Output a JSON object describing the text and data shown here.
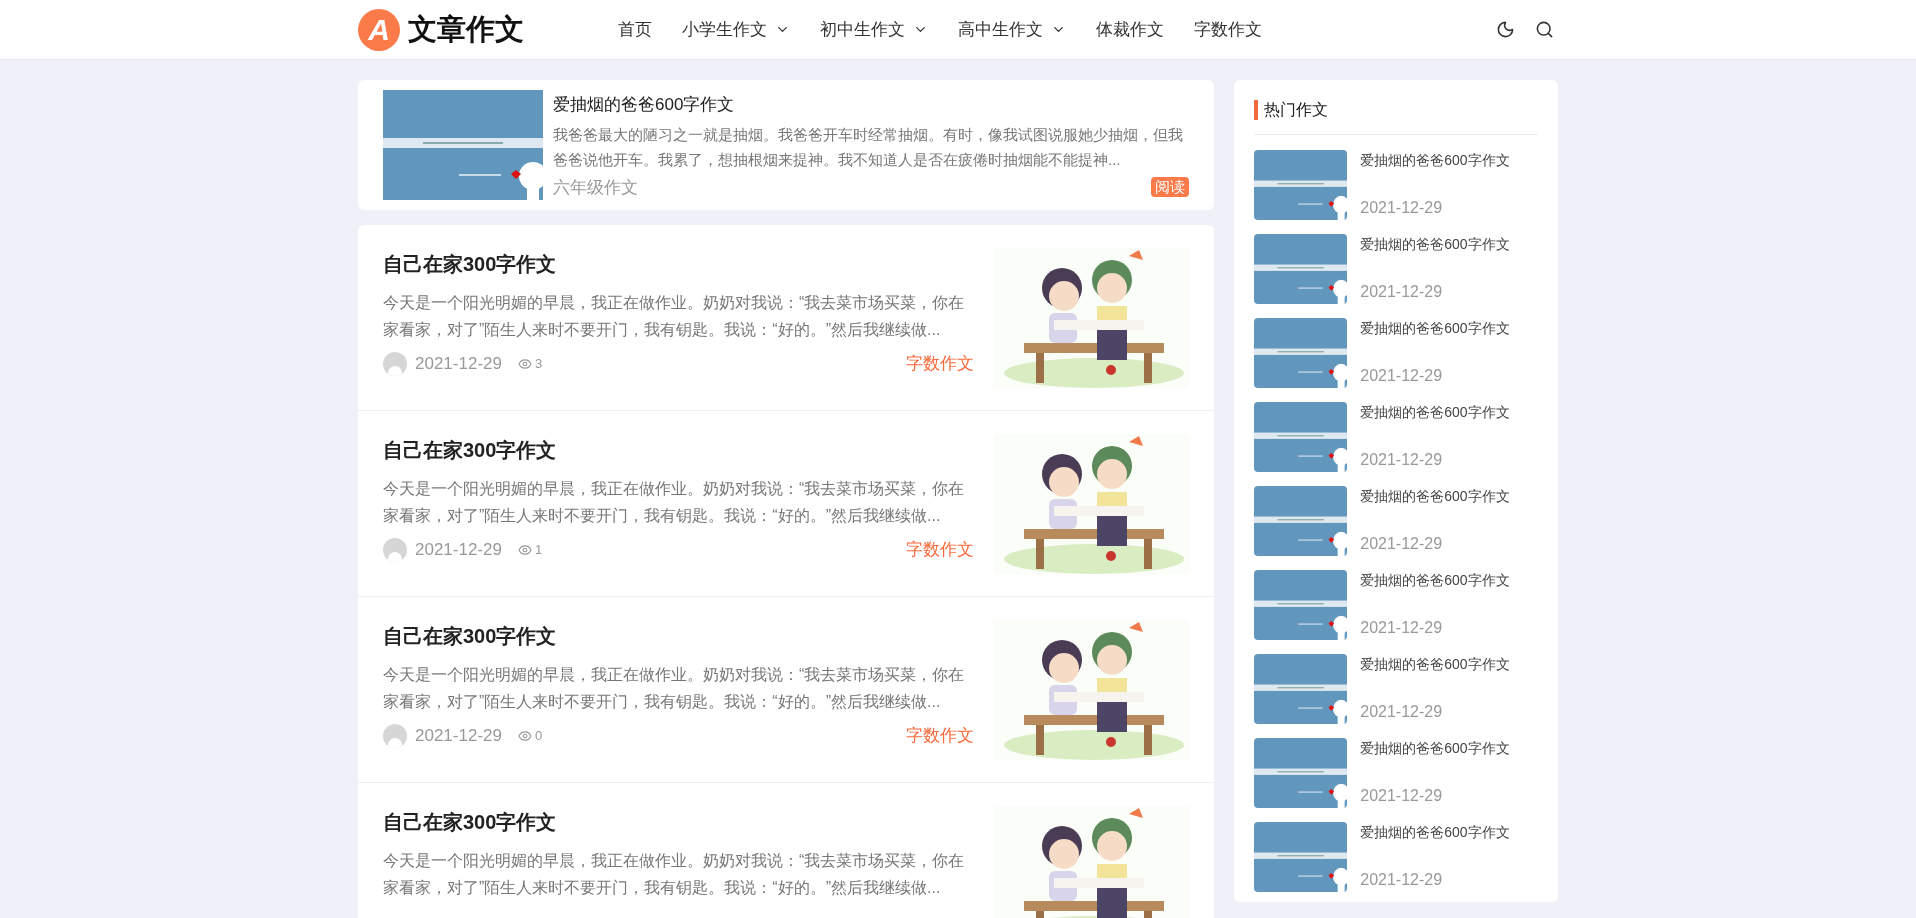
{
  "header": {
    "logo_letter": "A",
    "site_name": "文章作文",
    "nav": [
      {
        "label": "首页",
        "dropdown": false
      },
      {
        "label": "小学生作文",
        "dropdown": true
      },
      {
        "label": "初中生作文",
        "dropdown": true
      },
      {
        "label": "高中生作文",
        "dropdown": true
      },
      {
        "label": "体裁作文",
        "dropdown": false
      },
      {
        "label": "字数作文",
        "dropdown": false
      }
    ]
  },
  "featured": {
    "title": "爱抽烟的爸爸600字作文",
    "excerpt": "我爸爸最大的陋习之一就是抽烟。我爸爸开车时经常抽烟。有时，像我试图说服她少抽烟，但我爸爸说他开车。我累了，想抽根烟来提神。我不知道人是否在疲倦时抽烟能不能提神...",
    "category": "六年级作文",
    "button": "阅读"
  },
  "articles": [
    {
      "title": "自己在家300字作文",
      "excerpt": "今天是一个阳光明媚的早晨，我正在做作业。奶奶对我说：“我去菜市场买菜，你在家看家，对了”陌生人来时不要开门，我有钥匙。我说：“好的。”然后我继续做...",
      "date": "2021-12-29",
      "views": "3",
      "category": "字数作文"
    },
    {
      "title": "自己在家300字作文",
      "excerpt": "今天是一个阳光明媚的早晨，我正在做作业。奶奶对我说：“我去菜市场买菜，你在家看家，对了”陌生人来时不要开门，我有钥匙。我说：“好的。”然后我继续做...",
      "date": "2021-12-29",
      "views": "1",
      "category": "字数作文"
    },
    {
      "title": "自己在家300字作文",
      "excerpt": "今天是一个阳光明媚的早晨，我正在做作业。奶奶对我说：“我去菜市场买菜，你在家看家，对了”陌生人来时不要开门，我有钥匙。我说：“好的。”然后我继续做...",
      "date": "2021-12-29",
      "views": "0",
      "category": "字数作文"
    },
    {
      "title": "自己在家300字作文",
      "excerpt": "今天是一个阳光明媚的早晨，我正在做作业。奶奶对我说：“我去菜市场买菜，你在家看家，对了”陌生人来时不要开门，我有钥匙。我说：“好的。”然后我继续做..."
    }
  ],
  "sidebar": {
    "title": "热门作文",
    "items": [
      {
        "title": "爱抽烟的爸爸600字作文",
        "date": "2021-12-29"
      },
      {
        "title": "爱抽烟的爸爸600字作文",
        "date": "2021-12-29"
      },
      {
        "title": "爱抽烟的爸爸600字作文",
        "date": "2021-12-29"
      },
      {
        "title": "爱抽烟的爸爸600字作文",
        "date": "2021-12-29"
      },
      {
        "title": "爱抽烟的爸爸600字作文",
        "date": "2021-12-29"
      },
      {
        "title": "爱抽烟的爸爸600字作文",
        "date": "2021-12-29"
      },
      {
        "title": "爱抽烟的爸爸600字作文",
        "date": "2021-12-29"
      },
      {
        "title": "爱抽烟的爸爸600字作文",
        "date": "2021-12-29"
      },
      {
        "title": "爱抽烟的爸爸600字作文",
        "date": "2021-12-29"
      }
    ]
  }
}
